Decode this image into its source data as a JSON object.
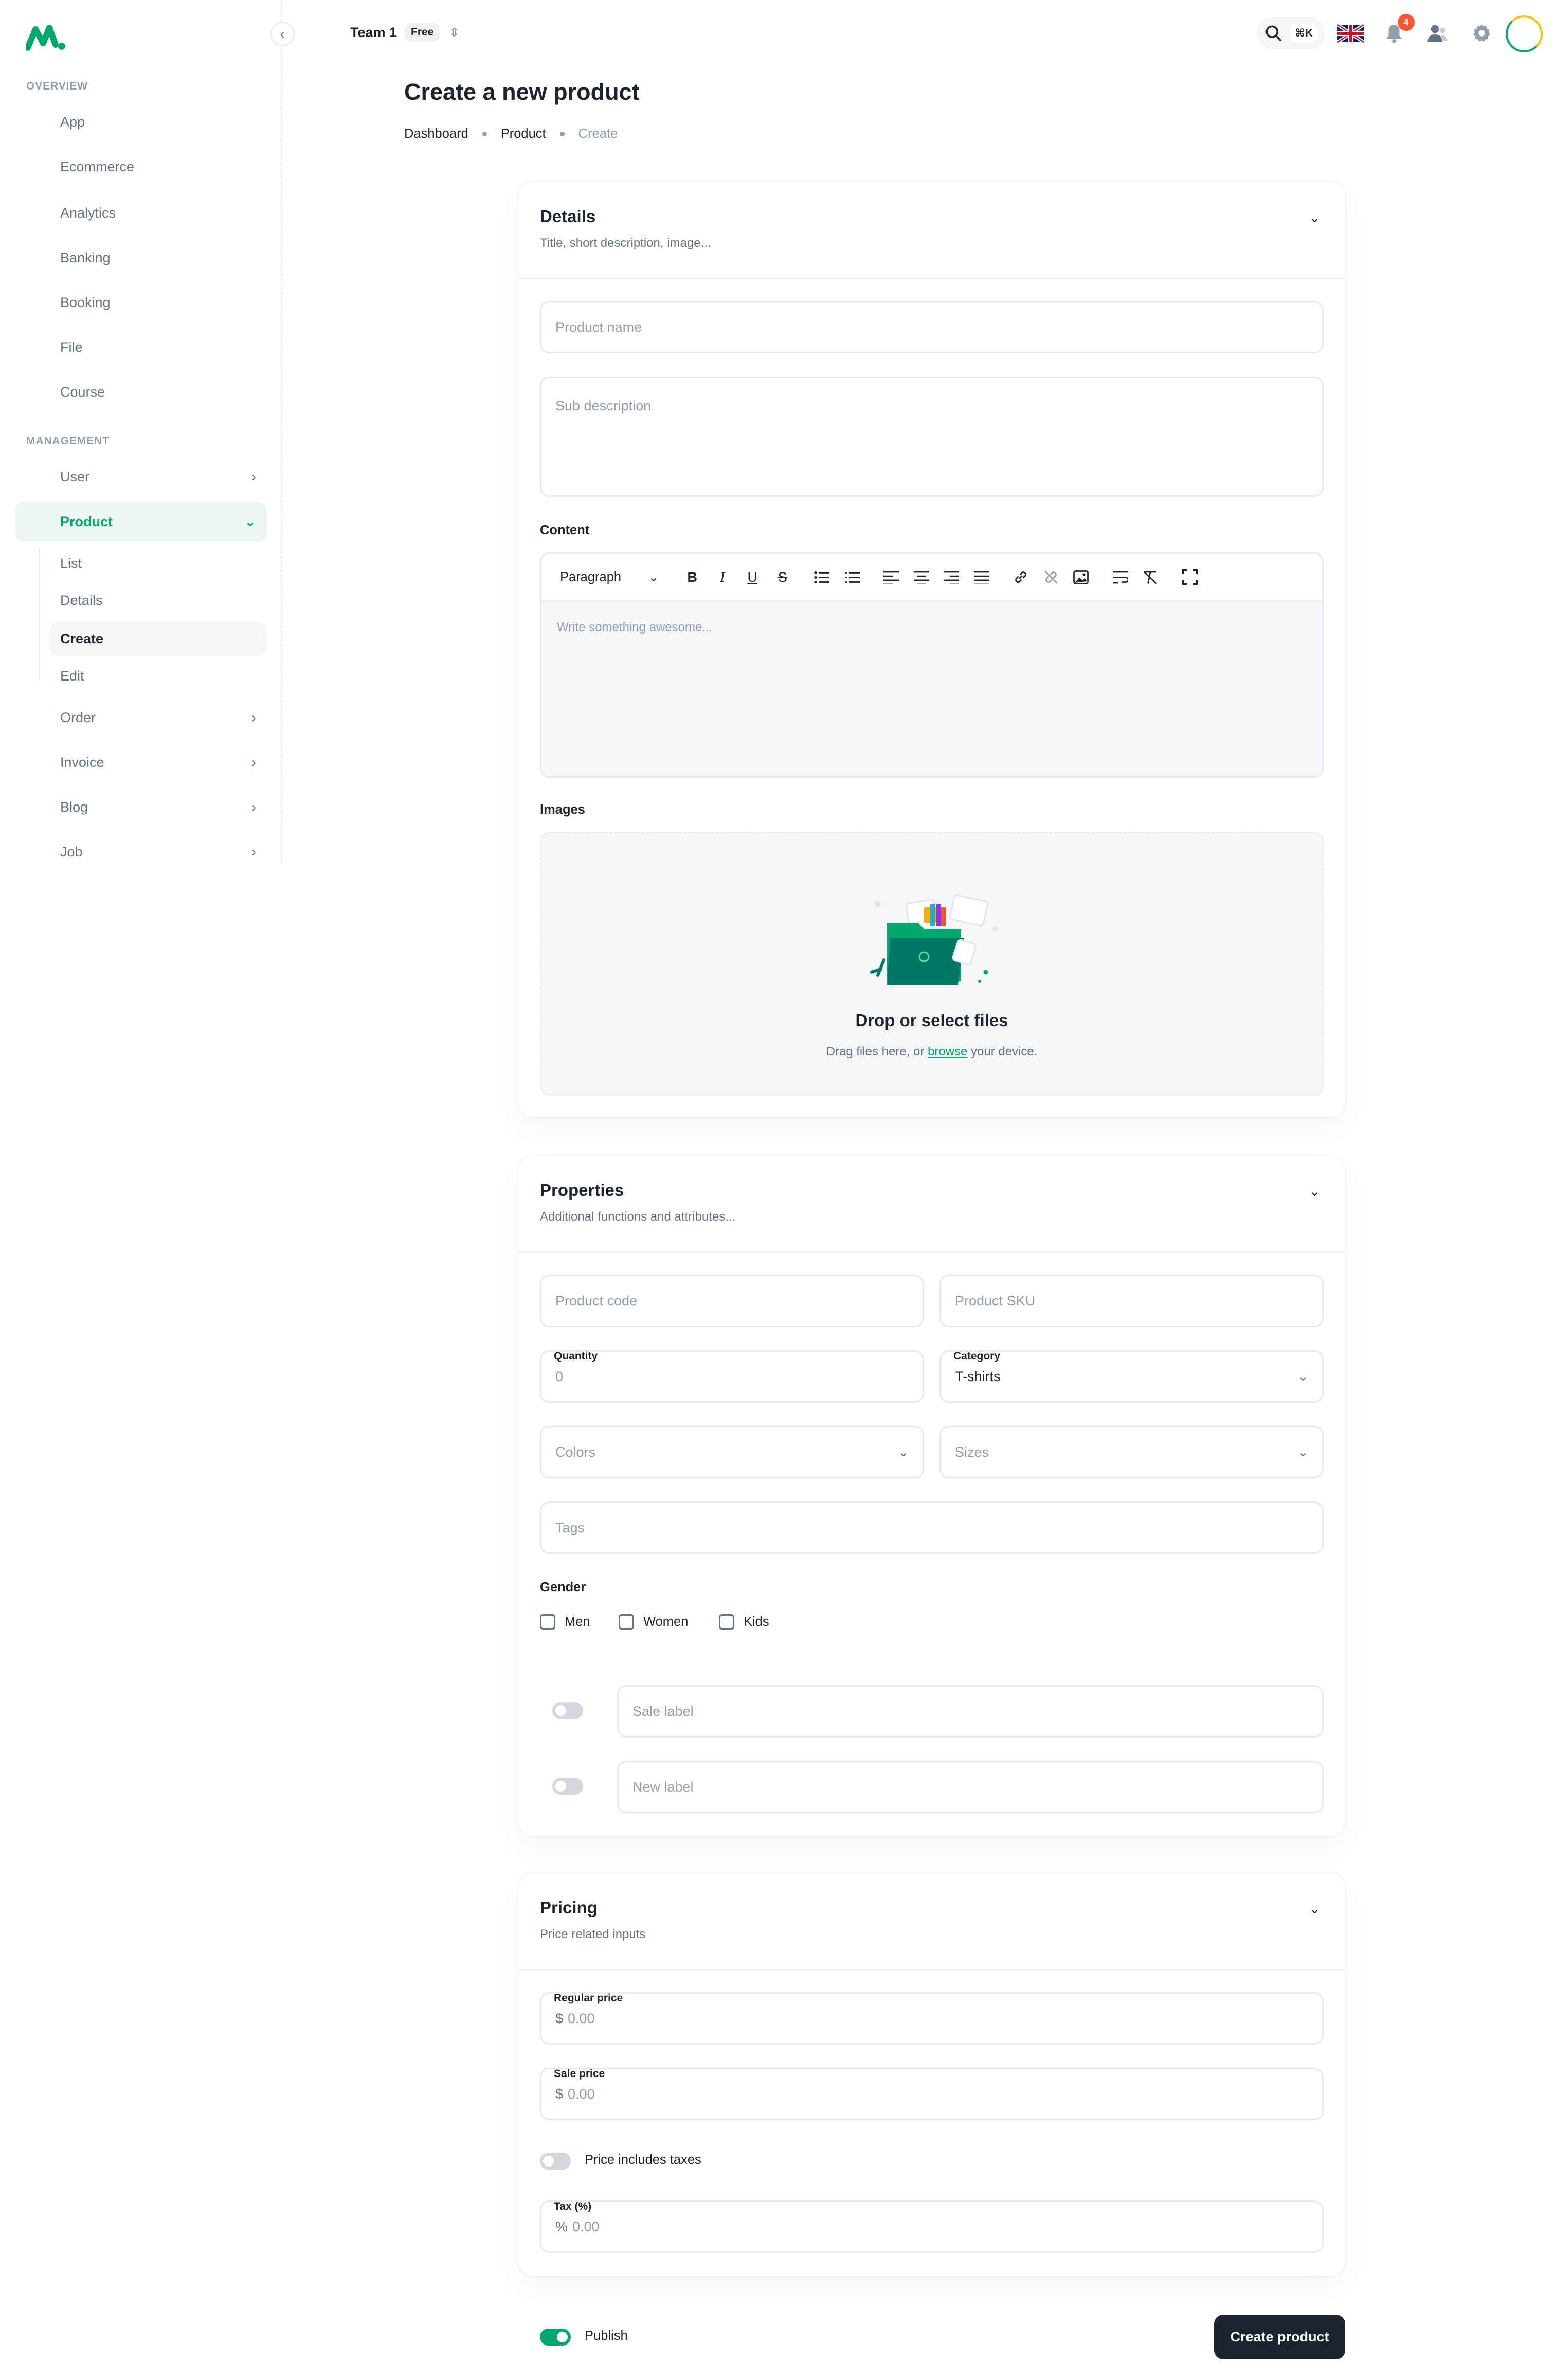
{
  "header": {
    "team_name": "Team 1",
    "team_plan": "Free",
    "search_shortcut": "⌘K",
    "notification_count": "4",
    "language_flag": "uk-flag-icon"
  },
  "sidebar": {
    "overview_label": "Overview",
    "management_label": "Management",
    "overview_items": [
      "App",
      "Ecommerce",
      "Analytics",
      "Banking",
      "Booking",
      "File",
      "Course"
    ],
    "management_items": {
      "user": "User",
      "product": "Product",
      "product_children": [
        "List",
        "Details",
        "Create",
        "Edit"
      ],
      "order": "Order",
      "invoice": "Invoice",
      "blog": "Blog",
      "job": "Job"
    }
  },
  "page": {
    "title": "Create a new product",
    "breadcrumb": [
      "Dashboard",
      "Product",
      "Create"
    ]
  },
  "details": {
    "title": "Details",
    "subtitle": "Title, short description, image...",
    "product_name_placeholder": "Product name",
    "sub_description_placeholder": "Sub description",
    "content_label": "Content",
    "paragraph_select": "Paragraph",
    "editor_placeholder": "Write something awesome...",
    "images_label": "Images",
    "upload_title": "Drop or select files",
    "upload_sub_before": "Drag files here, or ",
    "upload_link": "browse",
    "upload_sub_after": " your device."
  },
  "properties": {
    "title": "Properties",
    "subtitle": "Additional functions and attributes...",
    "product_code_placeholder": "Product code",
    "product_sku_placeholder": "Product SKU",
    "quantity_label": "Quantity",
    "quantity_value": "0",
    "category_label": "Category",
    "category_value": "T-shirts",
    "colors_placeholder": "Colors",
    "sizes_placeholder": "Sizes",
    "tags_placeholder": "Tags",
    "gender_label": "Gender",
    "gender_options": [
      "Men",
      "Women",
      "Kids"
    ],
    "sale_label_placeholder": "Sale label",
    "new_label_placeholder": "New label"
  },
  "pricing": {
    "title": "Pricing",
    "subtitle": "Price related inputs",
    "regular_price_label": "Regular price",
    "regular_price_value": "0.00",
    "sale_price_label": "Sale price",
    "sale_price_value": "0.00",
    "currency_symbol": "$",
    "taxes_toggle_label": "Price includes taxes",
    "tax_label": "Tax (%)",
    "tax_symbol": "%",
    "tax_value": "0.00"
  },
  "footer": {
    "publish_label": "Publish",
    "publish_on": true,
    "create_button": "Create product"
  },
  "colors": {
    "primary": "#00a76f",
    "text": "#1c252e",
    "muted": "#919eab",
    "error": "#ff5630"
  }
}
